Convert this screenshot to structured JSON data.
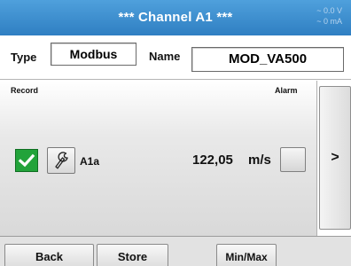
{
  "titlebar": {
    "title": "*** Channel A1 ***",
    "reading_voltage": "~ 0.0 V",
    "reading_current": "~ 0 mA"
  },
  "config": {
    "type_label": "Type",
    "type_value": "Modbus",
    "name_label": "Name",
    "name_value": "MOD_VA500"
  },
  "panel": {
    "record_label": "Record",
    "alarm_label": "Alarm",
    "record_checked": true,
    "channel_id": "A1a",
    "value": "122,05",
    "unit": "m/s",
    "next_button": ">"
  },
  "buttons": {
    "back": "Back",
    "store": "Store",
    "minmax": "Min/Max"
  },
  "colors": {
    "titlebar": "#3a8bcf",
    "check": "#22a33a"
  },
  "icons": {
    "record": "checkmark-icon",
    "settings": "wrench-icon"
  }
}
